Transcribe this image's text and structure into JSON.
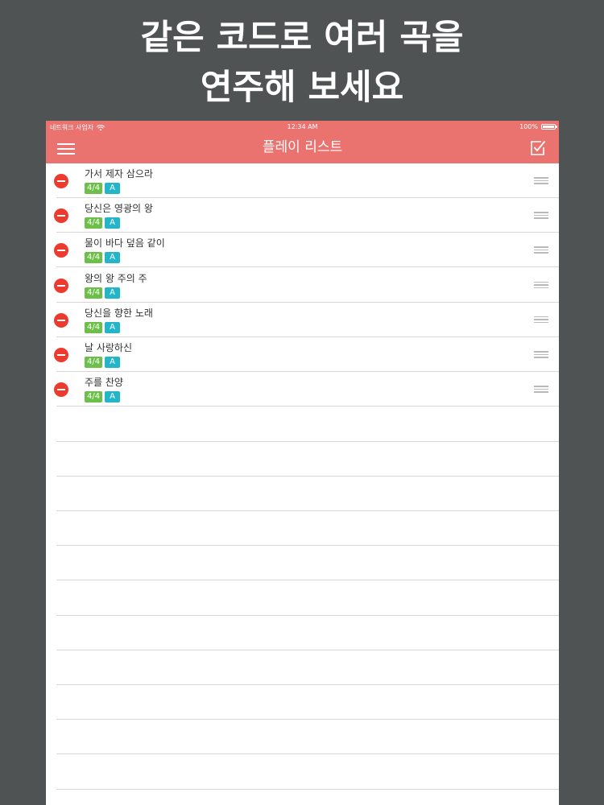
{
  "promo": {
    "line1": "같은 코드로 여러 곡을",
    "line2": "연주해 보세요"
  },
  "status_bar": {
    "carrier": "네트워크 사업자",
    "time": "12:34 AM",
    "battery": "100%"
  },
  "nav": {
    "title": "플레이 리스트",
    "menu_icon": "hamburger-menu-icon",
    "edit_icon": "checkbox-edit-icon"
  },
  "colors": {
    "accent": "#ea7370",
    "delete": "#ee3a2e",
    "time_signature_tag": "#6cbf48",
    "key_tag": "#25b5c9",
    "background": "#4f5354"
  },
  "playlist": [
    {
      "title": "가서 제자 삼으라",
      "time_signature": "4/4",
      "key": "A"
    },
    {
      "title": "당신은 영광의 왕",
      "time_signature": "4/4",
      "key": "A"
    },
    {
      "title": "물이 바다 덮음 같이",
      "time_signature": "4/4",
      "key": "A"
    },
    {
      "title": "왕의 왕 주의 주",
      "time_signature": "4/4",
      "key": "A"
    },
    {
      "title": "당신을 향한 노래",
      "time_signature": "4/4",
      "key": "A"
    },
    {
      "title": "날 사랑하신",
      "time_signature": "4/4",
      "key": "A"
    },
    {
      "title": "주를 찬양",
      "time_signature": "4/4",
      "key": "A"
    }
  ]
}
